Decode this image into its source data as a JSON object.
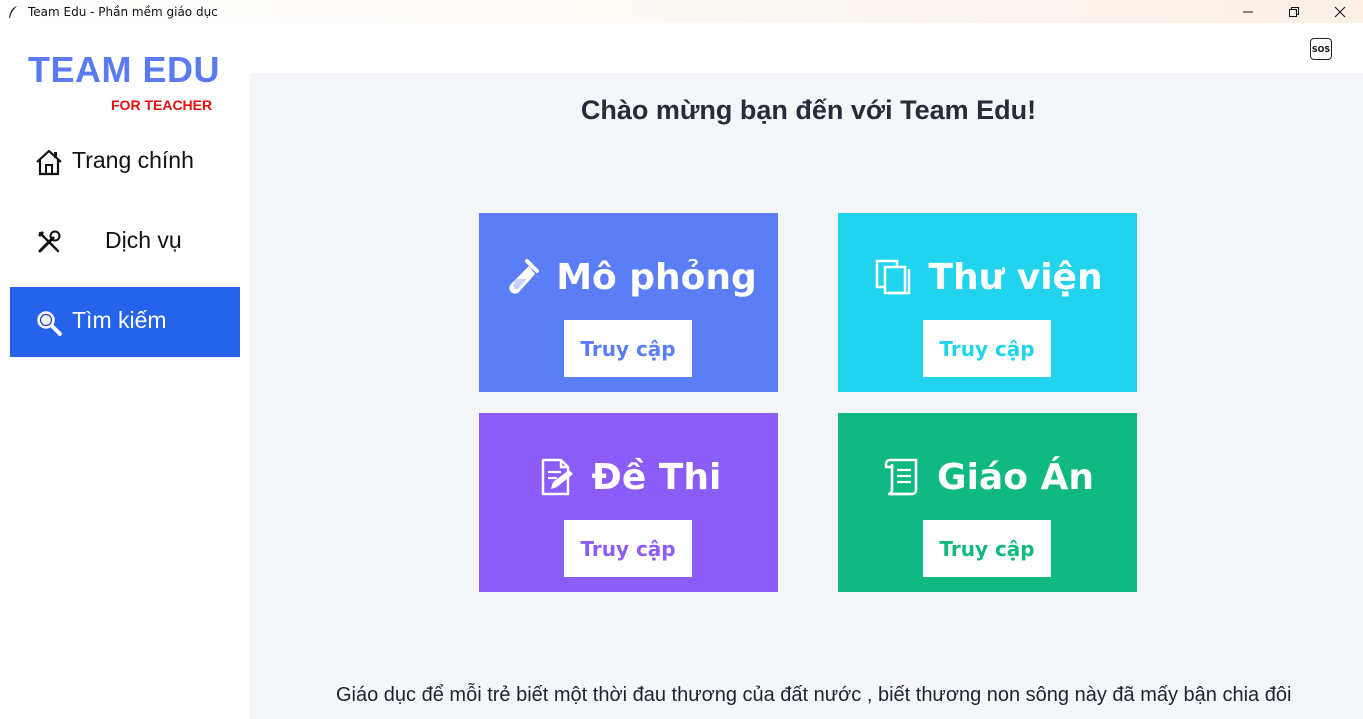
{
  "window": {
    "title": "Team Edu - Phần mềm giáo dục"
  },
  "sidebar": {
    "brand": "TEAM EDU",
    "brand_sub": "FOR TEACHER",
    "items": [
      {
        "label": "Trang chính",
        "icon": "home-icon",
        "active": false
      },
      {
        "label": "Dịch vụ",
        "icon": "tools-icon",
        "active": false
      },
      {
        "label": "Tìm kiếm",
        "icon": "search-icon",
        "active": true
      }
    ]
  },
  "header": {
    "sos_label": "SOS"
  },
  "main": {
    "welcome": "Chào mừng bạn đến với Team Edu!",
    "cards": [
      {
        "title": "Mô phỏng",
        "button": "Truy cập",
        "icon": "test-tube-icon",
        "color": "#5b7ef6"
      },
      {
        "title": "Thư viện",
        "button": "Truy cập",
        "icon": "copy-icon",
        "color": "#22d3ee"
      },
      {
        "title": "Đề Thi",
        "button": "Truy cập",
        "icon": "edit-document-icon",
        "color": "#8b5cf6"
      },
      {
        "title": "Giáo Án",
        "button": "Truy cập",
        "icon": "scroll-icon",
        "color": "#10b981"
      }
    ],
    "footer_quote": "Giáo dục để mỗi trẻ biết một thời đau thương của đất nước , biết thương non sông này đã mấy bận chia đôi"
  },
  "colors": {
    "accent": "#2563eb",
    "brand": "#5b7bf4",
    "brand_sub": "#e60d0d",
    "main_bg": "#f5f6fa"
  }
}
